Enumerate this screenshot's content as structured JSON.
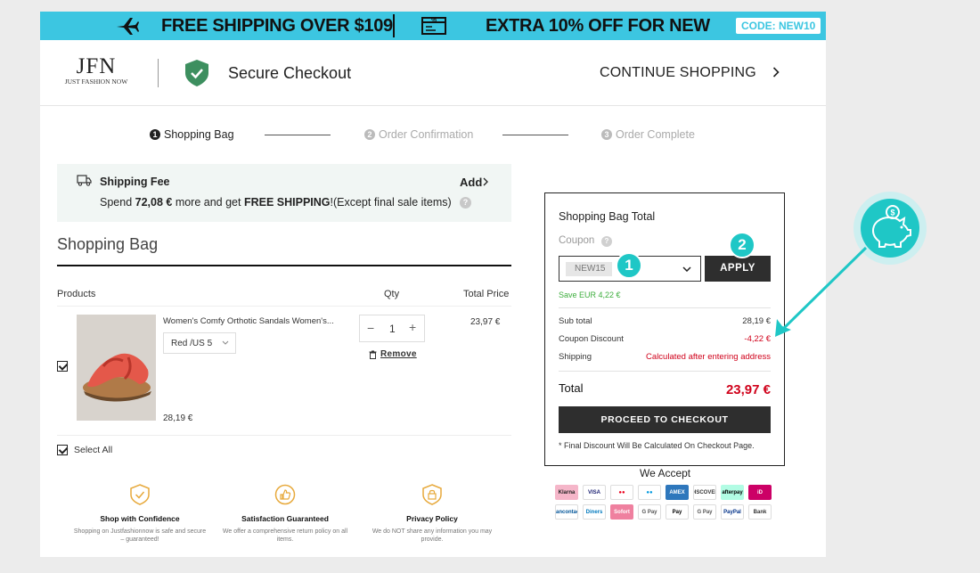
{
  "banner": {
    "shipping_text": "FREE SHIPPING OVER $109",
    "discount_text": "EXTRA 10% OFF FOR NEW",
    "code": "CODE: NEW10",
    "accent_color": "#3cc6e1"
  },
  "header": {
    "logo_main": "JFN",
    "logo_sub": "JUST FASHION NOW",
    "secure_label": "Secure Checkout",
    "continue_label": "CONTINUE SHOPPING"
  },
  "steps": [
    {
      "num": "1",
      "label": "Shopping Bag",
      "active": true
    },
    {
      "num": "2",
      "label": "Order Confirmation",
      "active": false
    },
    {
      "num": "3",
      "label": "Order Complete",
      "active": false
    }
  ],
  "shipping_notice": {
    "title": "Shipping Fee",
    "add_label": "Add",
    "msg_prefix": "Spend ",
    "amount": "72,08 €",
    "msg_mid": " more and get ",
    "free": "FREE SHIPPING",
    "msg_suffix": "!(Except final sale items)"
  },
  "bag": {
    "title": "Shopping Bag",
    "col_products": "Products",
    "col_qty": "Qty",
    "col_total": "Total Price",
    "select_all": "Select All",
    "items": [
      {
        "name": "Women's Comfy Orthotic Sandals Women's...",
        "variant": "Red /US 5",
        "unit_price": "28,19 €",
        "qty": "1",
        "total": "23,97 €",
        "remove_label": "Remove",
        "checked": true
      }
    ]
  },
  "features": [
    {
      "title": "Shop with Confidence",
      "desc": "Shopping on Justfashionnow is safe and secure – guaranteed!"
    },
    {
      "title": "Satisfaction Guaranteed",
      "desc": "We offer a comprehensive return policy on all items."
    },
    {
      "title": "Privacy Policy",
      "desc": "We do NOT share any information you may provide."
    }
  ],
  "summary": {
    "title": "Shopping Bag Total",
    "coupon_label": "Coupon",
    "coupon_value": "NEW15",
    "apply_label": "APPLY",
    "save_text": "Save EUR 4,22 €",
    "subtotal_label": "Sub total",
    "subtotal_value": "28,19 €",
    "discount_label": "Coupon Discount",
    "discount_value": "-4,22 €",
    "shipping_label": "Shipping",
    "shipping_value": "Calculated after entering address",
    "total_label": "Total",
    "total_value": "23,97 €",
    "checkout_label": "PROCEED TO CHECKOUT",
    "note": "* Final Discount Will Be Calculated On Checkout Page."
  },
  "payments": {
    "title": "We Accept",
    "methods": [
      {
        "name": "Klarna",
        "bg": "#f5b6c9",
        "fg": "#222"
      },
      {
        "name": "VISA",
        "bg": "#fff",
        "fg": "#1a1f71"
      },
      {
        "name": "●●",
        "bg": "#fff",
        "fg": "#eb001b"
      },
      {
        "name": "●●",
        "bg": "#fff",
        "fg": "#0099df"
      },
      {
        "name": "AMEX",
        "bg": "#2e77bc",
        "fg": "#fff"
      },
      {
        "name": "DISCOVER",
        "bg": "#fff",
        "fg": "#333"
      },
      {
        "name": "afterpay",
        "bg": "#b2fce4",
        "fg": "#000"
      },
      {
        "name": "iD",
        "bg": "#cc0066",
        "fg": "#fff"
      },
      {
        "name": "Bancontact",
        "bg": "#fff",
        "fg": "#005498"
      },
      {
        "name": "Diners",
        "bg": "#fff",
        "fg": "#0079be"
      },
      {
        "name": "Sofort",
        "bg": "#ef809f",
        "fg": "#fff"
      },
      {
        "name": "G Pay",
        "bg": "#fff",
        "fg": "#555"
      },
      {
        "name": "Pay",
        "bg": "#fff",
        "fg": "#000"
      },
      {
        "name": "G Pay",
        "bg": "#fff",
        "fg": "#555"
      },
      {
        "name": "PayPal",
        "bg": "#fff",
        "fg": "#003087"
      },
      {
        "name": "Bank",
        "bg": "#fff",
        "fg": "#333"
      }
    ]
  },
  "annotations": {
    "step1": "1",
    "step2": "2",
    "accent": "#1fc7c6"
  }
}
